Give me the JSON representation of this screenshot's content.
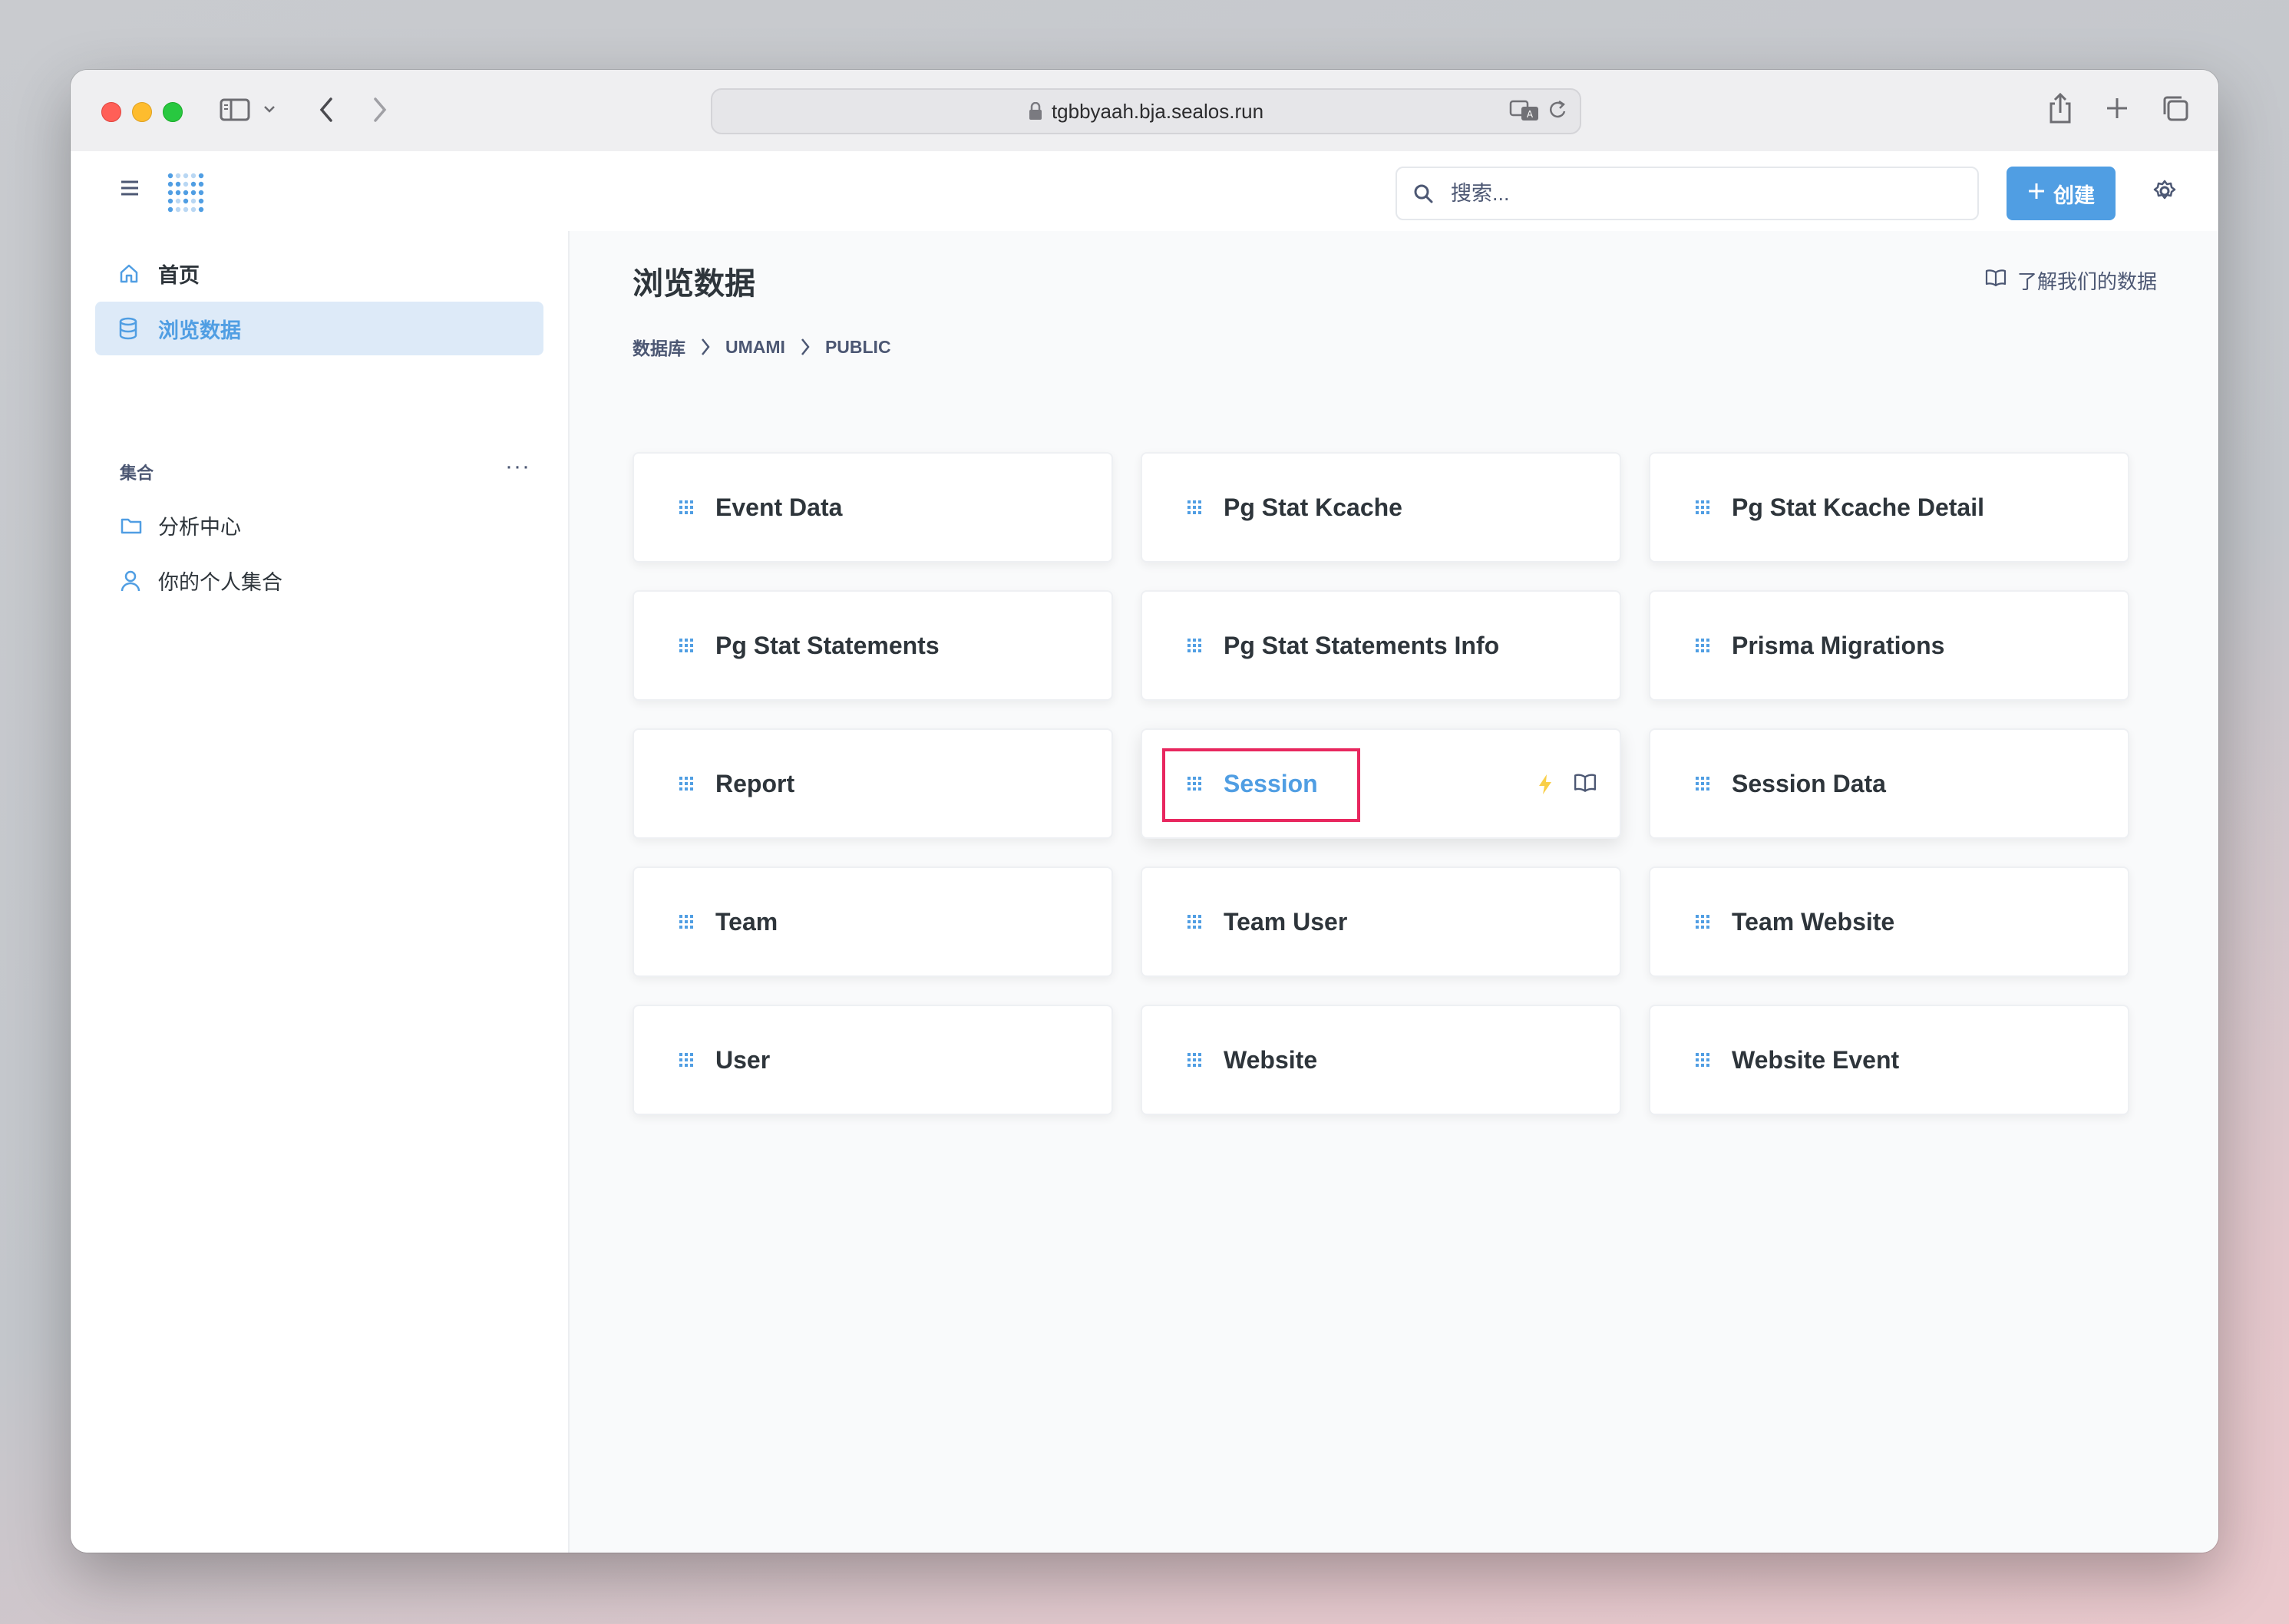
{
  "browser": {
    "url": "tgbbyaah.bja.sealos.run"
  },
  "app": {
    "search_placeholder": "搜索...",
    "create_label": "创建"
  },
  "sidebar": {
    "nav": [
      {
        "label": "首页",
        "icon": "home-icon"
      },
      {
        "label": "浏览数据",
        "icon": "database-icon",
        "active": true
      }
    ],
    "collections_label": "集合",
    "collections": [
      {
        "label": "分析中心",
        "icon": "folder-icon"
      },
      {
        "label": "你的个人集合",
        "icon": "person-icon"
      }
    ]
  },
  "main": {
    "title": "浏览数据",
    "learn_link": "了解我们的数据",
    "breadcrumb": [
      "数据库",
      "UMAMI",
      "PUBLIC"
    ],
    "tables": [
      "Event Data",
      "Pg Stat Kcache",
      "Pg Stat Kcache Detail",
      "Pg Stat Statements",
      "Pg Stat Statements Info",
      "Prisma Migrations",
      "Report",
      "Session",
      "Session Data",
      "Team",
      "Team User",
      "Team Website",
      "User",
      "Website",
      "Website Event"
    ],
    "hovered_table": "Session"
  },
  "colors": {
    "brand": "#509ee3",
    "text": "#2e353b",
    "highlight": "#e8275f",
    "bolt": "#f9cf48"
  }
}
